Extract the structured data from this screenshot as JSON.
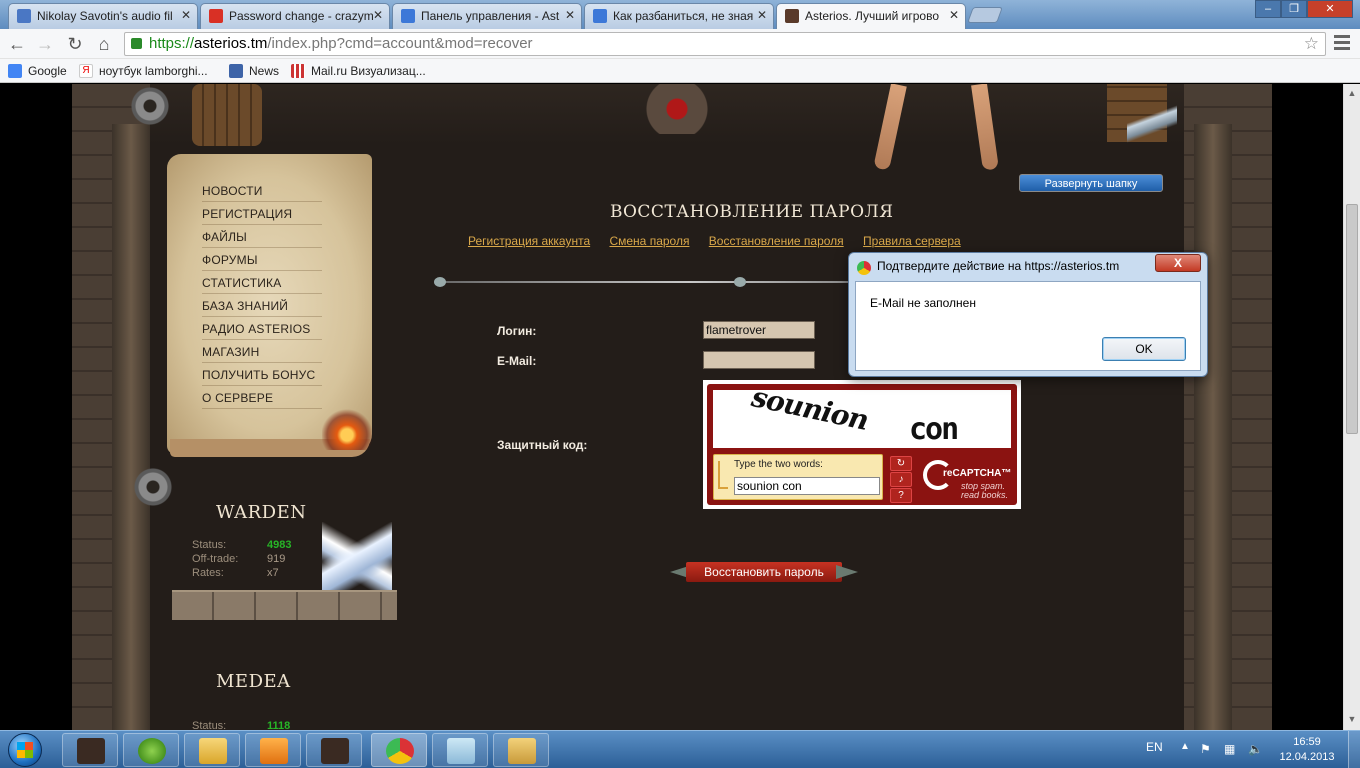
{
  "browser": {
    "tabs": [
      {
        "title": "Nikolay Savotin's audio fil",
        "favicon_color": "#4a77c4"
      },
      {
        "title": "Password change - crazym",
        "favicon_color": "#d93025"
      },
      {
        "title": "Панель управления - Ast",
        "favicon_color": "#3c78d8"
      },
      {
        "title": "Как разбаниться, не зная",
        "favicon_color": "#3c78d8"
      },
      {
        "title": "Asterios. Лучший игрово",
        "favicon_color": "#5a3a2a"
      }
    ],
    "url": {
      "scheme": "https://",
      "host": "asterios.tm",
      "path": "/index.php?cmd=account&mod=recover"
    },
    "bookmarks": [
      {
        "label": "Google",
        "icon": "google-icon"
      },
      {
        "label": "ноутбук lamborghi...",
        "icon": "yandex-icon"
      },
      {
        "label": "News",
        "icon": "news-icon"
      },
      {
        "label": "Mail.ru Визуализац...",
        "icon": "grid-icon"
      }
    ]
  },
  "site": {
    "expand_header_label": "Развернуть шапку",
    "menu": [
      "НОВОСТИ",
      "РЕГИСТРАЦИЯ",
      "ФАЙЛЫ",
      "ФОРУМЫ",
      "СТАТИСТИКА",
      "БАЗА ЗНАНИЙ",
      "РАДИО ASTERIOS",
      "МАГАЗИН",
      "ПОЛУЧИТЬ БОНУС",
      "О СЕРВЕРЕ"
    ],
    "servers": [
      {
        "name": "WARDEN",
        "status_label": "Status:",
        "status_value": "4983",
        "offtrade_label": "Off-trade:",
        "offtrade_value": "919",
        "rates_label": "Rates:",
        "rates_value": "x7"
      },
      {
        "name": "MEDEA",
        "status_label": "Status:",
        "status_value": "1118"
      }
    ],
    "page_heading": "ВОССТАНОВЛЕНИЕ ПАРОЛЯ",
    "links": [
      "Регистрация аккаунта",
      "Смена пароля",
      "Восстановление пароля",
      "Правила сервера"
    ],
    "form": {
      "login_label": "Логин:",
      "login_value": "flametrover",
      "email_label": "E-Mail:",
      "email_value": "",
      "captcha_label": "Защитный код:",
      "captcha_word1": "sounion",
      "captcha_word2": "con",
      "captcha_prompt": "Type the two words:",
      "captcha_input": "sounion con",
      "recaptcha_brand": "reCAPTCHA™",
      "recaptcha_tagline_1": "stop spam.",
      "recaptcha_tagline_2": "read books.",
      "submit_label": "Восстановить пароль"
    }
  },
  "dialog": {
    "title": "Подтвердите действие на https://asterios.tm",
    "message": "E-Mail не заполнен",
    "ok_label": "OK",
    "close_label": "X"
  },
  "taskbar": {
    "language": "EN",
    "time": "16:59",
    "date": "12.04.2013"
  }
}
